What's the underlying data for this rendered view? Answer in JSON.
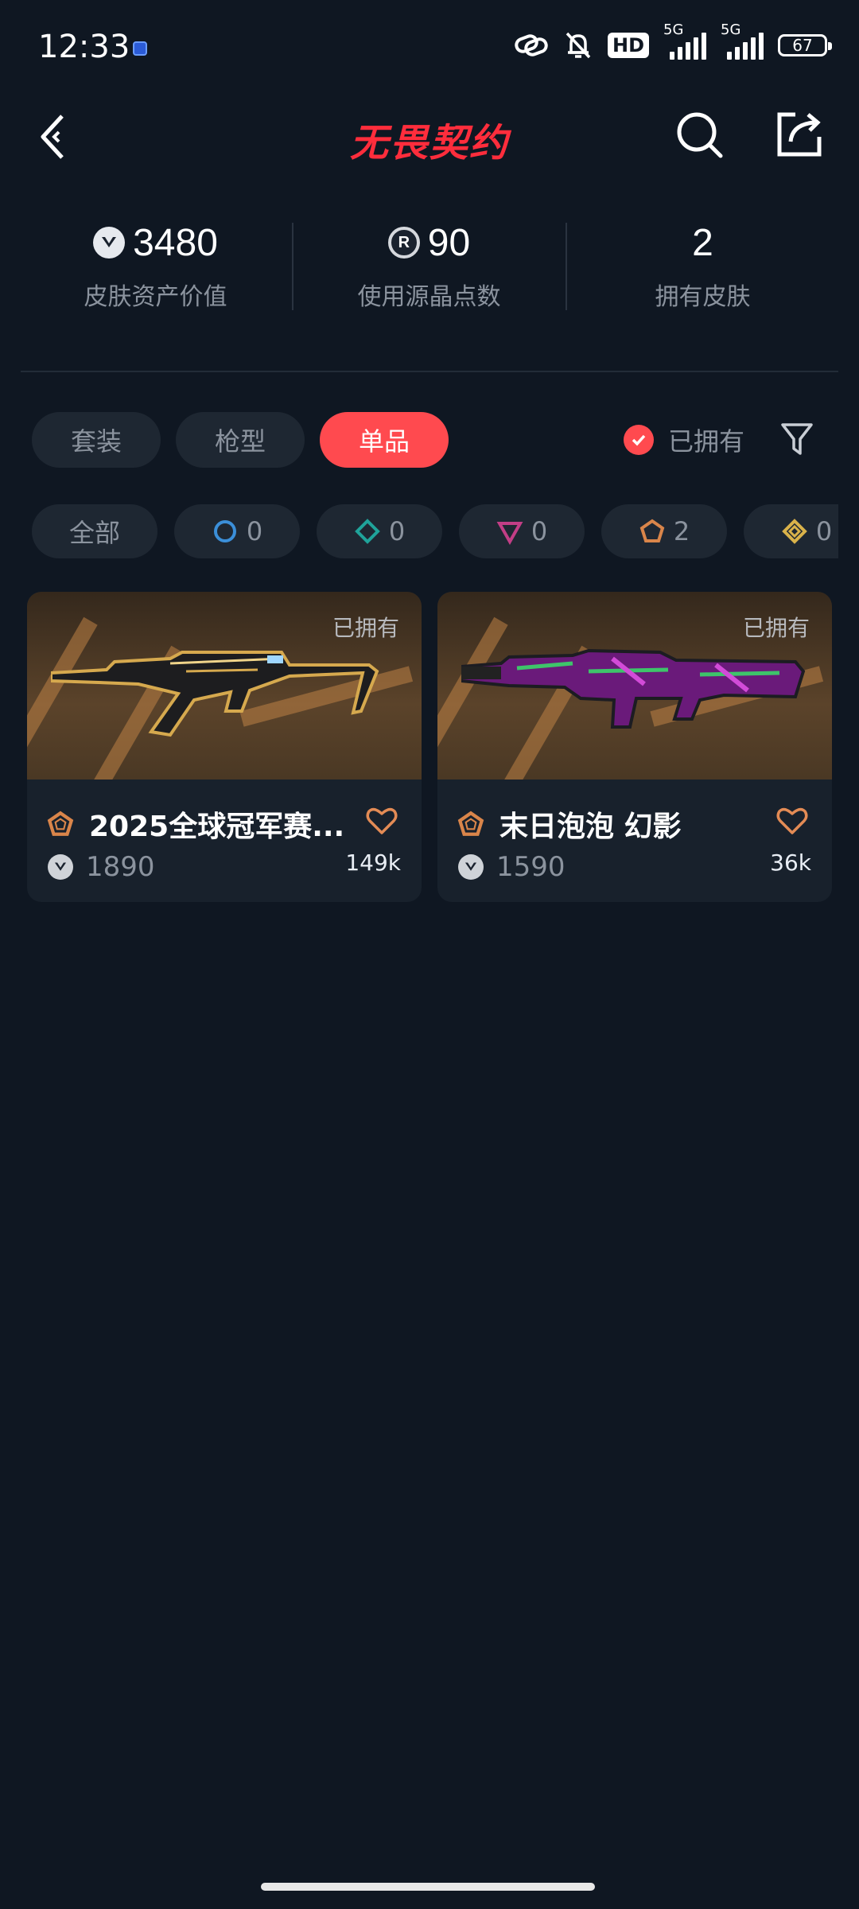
{
  "status_bar": {
    "time": "12:33",
    "network_badge": "HD",
    "signal_1_label": "5G",
    "signal_2_label": "5G",
    "battery": "67"
  },
  "header": {
    "logo_text": "无畏契约",
    "logo_color": "#ff2d3c"
  },
  "stats": [
    {
      "value": "3480",
      "label": "皮肤资产价值",
      "icon": "vp-icon"
    },
    {
      "value": "90",
      "label": "使用源晶点数",
      "icon": "radianite-icon"
    },
    {
      "value": "2",
      "label": "拥有皮肤",
      "icon": ""
    }
  ],
  "tabs": [
    {
      "label": "套装",
      "active": false
    },
    {
      "label": "枪型",
      "active": false
    },
    {
      "label": "单品",
      "active": true
    }
  ],
  "owned_filter": {
    "label": "已拥有",
    "checked": true
  },
  "rarity_filters": [
    {
      "label": "全部",
      "icon": ""
    },
    {
      "count": "0",
      "icon": "select-tier-icon",
      "color": "#3b8fd9"
    },
    {
      "count": "0",
      "icon": "deluxe-tier-icon",
      "color": "#1fa39a"
    },
    {
      "count": "0",
      "icon": "premium-tier-icon",
      "color": "#c23e86"
    },
    {
      "count": "2",
      "icon": "exclusive-tier-icon",
      "color": "#d9854a"
    },
    {
      "count": "0",
      "icon": "ultra-tier-icon",
      "color": "#d9b24a"
    }
  ],
  "cards": [
    {
      "owned_tag": "已拥有",
      "name": "2025全球冠军赛...",
      "price": "1890",
      "likes": "149k",
      "tier_icon": "exclusive-tier-icon"
    },
    {
      "owned_tag": "已拥有",
      "name": "末日泡泡 幻影",
      "price": "1590",
      "likes": "36k",
      "tier_icon": "exclusive-tier-icon"
    }
  ],
  "accent_color": "#ff4a4f",
  "background_color": "#0f1722"
}
